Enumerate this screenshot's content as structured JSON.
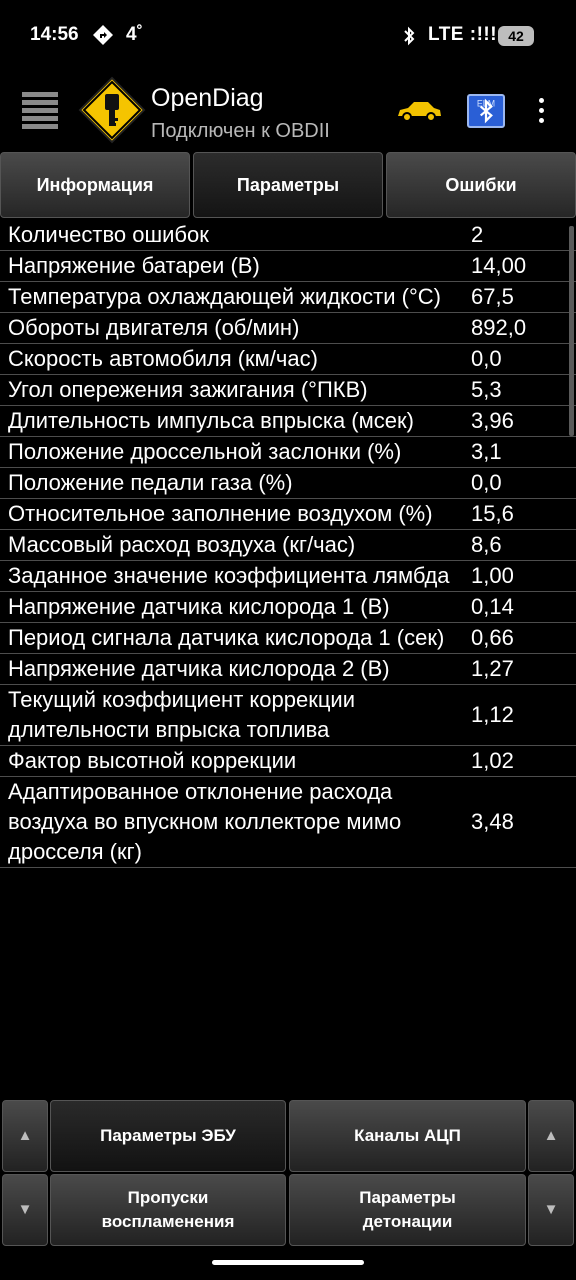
{
  "status_bar": {
    "time": "14:56",
    "temperature": "4˚",
    "network": "LTE :!!!",
    "battery": "42"
  },
  "app_bar": {
    "title": "OpenDiag",
    "subtitle": "Подключен к OBDII",
    "bt_button_label": "ELM"
  },
  "tabs": [
    {
      "label": "Информация",
      "active": false
    },
    {
      "label": "Параметры",
      "active": true
    },
    {
      "label": "Ошибки",
      "active": false
    }
  ],
  "parameters": [
    {
      "name": "Количество ошибок",
      "value": "2"
    },
    {
      "name": "Напряжение батареи (В)",
      "value": "14,00"
    },
    {
      "name": "Температура охлаждающей жидкости (°C)",
      "value": "67,5"
    },
    {
      "name": "Обороты двигателя (об/мин)",
      "value": "892,0"
    },
    {
      "name": "Скорость автомобиля (км/час)",
      "value": "0,0"
    },
    {
      "name": "Угол опережения зажигания (°ПКВ)",
      "value": "5,3"
    },
    {
      "name": "Длительность импульса впрыска (мсек)",
      "value": "3,96"
    },
    {
      "name": "Положение дроссельной заслонки (%)",
      "value": "3,1"
    },
    {
      "name": "Положение педали газа (%)",
      "value": "0,0"
    },
    {
      "name": "Относительное заполнение воздухом (%)",
      "value": "15,6"
    },
    {
      "name": "Массовый расход воздуха (кг/час)",
      "value": "8,6"
    },
    {
      "name": "Заданное значение коэффициента лямбда",
      "value": "1,00"
    },
    {
      "name": "Напряжение датчика кислорода 1 (В)",
      "value": "0,14"
    },
    {
      "name": "Период сигнала датчика кислорода 1 (сек)",
      "value": "0,66"
    },
    {
      "name": "Напряжение датчика кислорода 2 (В)",
      "value": "1,27"
    },
    {
      "name": "Текущий коэффициент коррекции длительности впрыска топлива",
      "value": "1,12"
    },
    {
      "name": "Фактор высотной коррекции",
      "value": "1,02"
    },
    {
      "name": "Адаптированное отклонение расхода воздуха во впускном коллекторе мимо дросселя (кг)",
      "value": "3,48"
    }
  ],
  "bottom_buttons": {
    "ecu_params": "Параметры ЭБУ",
    "adc_channels": "Каналы АЦП",
    "misfires": "Пропуски воспламенения",
    "knock_params": "Параметры детонации",
    "up_arrow": "▲",
    "down_arrow": "▼"
  },
  "colors": {
    "background": "#000000",
    "car_icon": "#f2c200",
    "logo_yellow": "#f5c400",
    "bluetooth_button": "#2a5fd6"
  }
}
